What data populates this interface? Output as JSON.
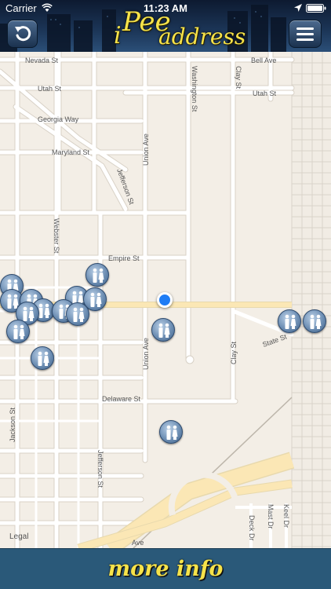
{
  "status_bar": {
    "carrier": "Carrier",
    "time": "11:23 AM"
  },
  "header": {
    "logo": {
      "i": "i",
      "pee": "Pee",
      "address": "address"
    },
    "back_icon": "undo-icon",
    "menu_icon": "hamburger-icon"
  },
  "map": {
    "streets": {
      "nevada": "Nevada St",
      "bell": "Bell Ave",
      "utah_left": "Utah St",
      "utah_right": "Utah St",
      "georgia": "Georgia Way",
      "maryland": "Maryland St",
      "washington": "Washington St",
      "clay_top": "Clay St",
      "union_top": "Union Ave",
      "jefferson_top": "Jefferson St",
      "webster": "Webster St",
      "empire": "Empire St",
      "union_bottom": "Union Ave",
      "clay_bottom": "Clay St",
      "state": "State St",
      "delaware": "Delaware St",
      "jackson": "Jackson St",
      "jefferson_bottom": "Jefferson St",
      "keel": "Keel Dr",
      "mast": "Mast Dr",
      "deck": "Deck Dr",
      "ave": "Ave"
    },
    "legal": "Legal",
    "poi_icon": "restroom-icon"
  },
  "footer": {
    "more_info": "more info"
  },
  "colors": {
    "map_bg": "#f3eee6",
    "road": "#ffffff",
    "highway": "#fbe7b5",
    "accent": "#f6e34a",
    "footer_bg": "#2a5979",
    "user_dot": "#1e7cf5"
  }
}
